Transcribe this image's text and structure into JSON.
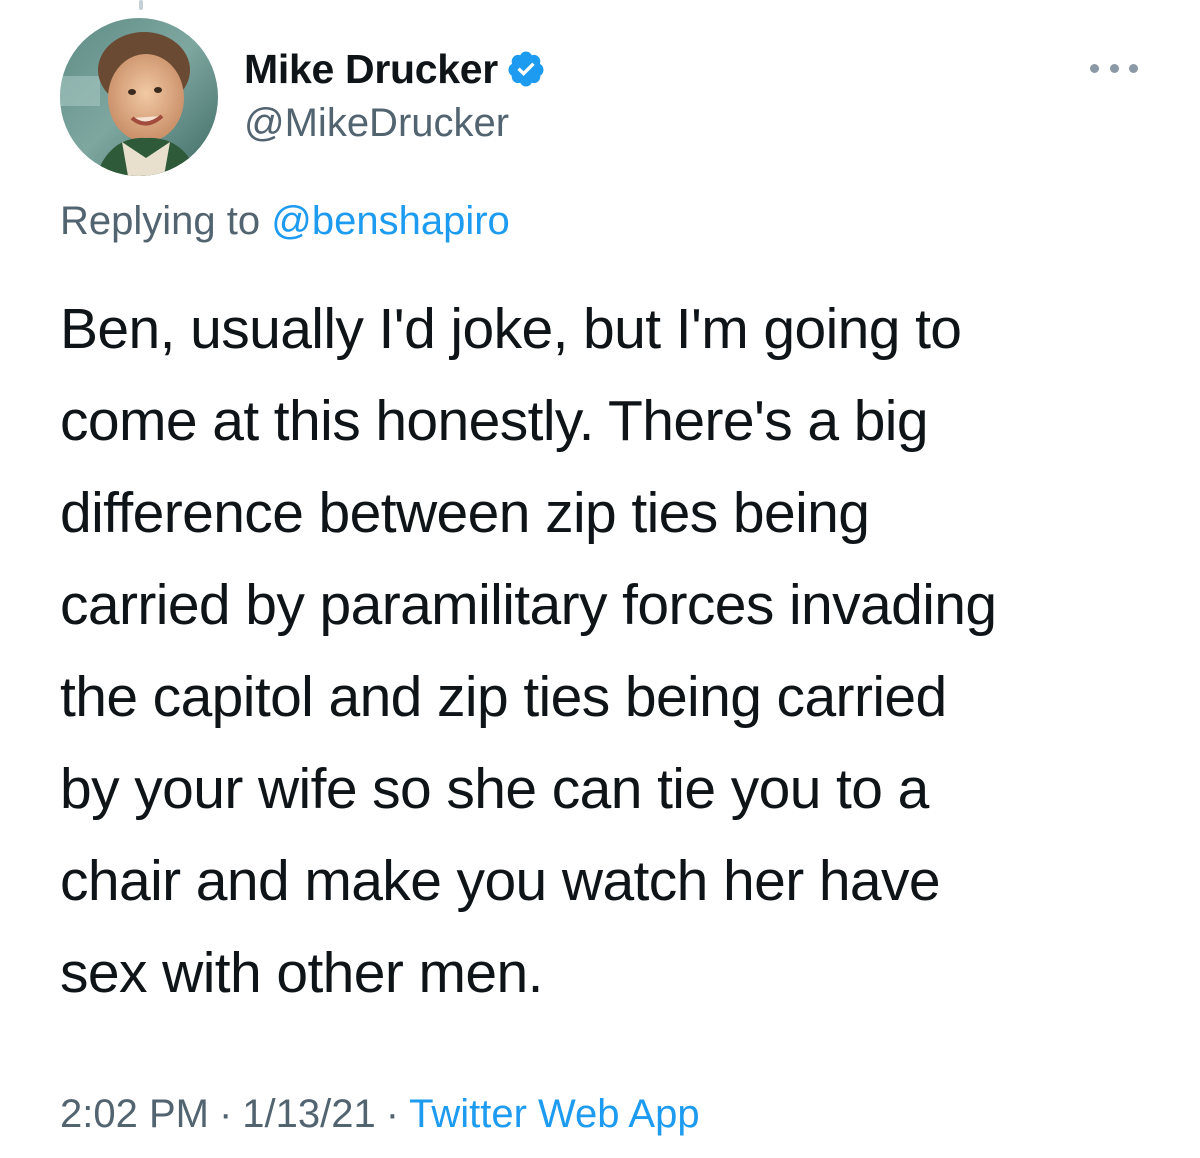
{
  "author": {
    "name": "Mike Drucker",
    "handle": "@MikeDrucker",
    "verified": true
  },
  "reply": {
    "prefix": "Replying to",
    "handle": "@benshapiro"
  },
  "tweet": {
    "lines": [
      "Ben, usually I'd joke, but I'm going to",
      "come at this honestly. There's a big",
      "difference between zip ties being",
      "carried by paramilitary forces invading",
      "the capitol and zip ties being carried",
      "by your wife so she can tie you to a",
      "chair and make you watch her have",
      "sex with other men."
    ]
  },
  "meta": {
    "time": "2:02 PM",
    "separator": "·",
    "date": "1/13/21",
    "source": "Twitter Web App"
  },
  "icons": {
    "verified": "verified-badge-icon",
    "more": "more-options-icon"
  },
  "colors": {
    "accent": "#1d9bf0",
    "secondary_text": "#536471",
    "primary_text": "#0f1419"
  }
}
